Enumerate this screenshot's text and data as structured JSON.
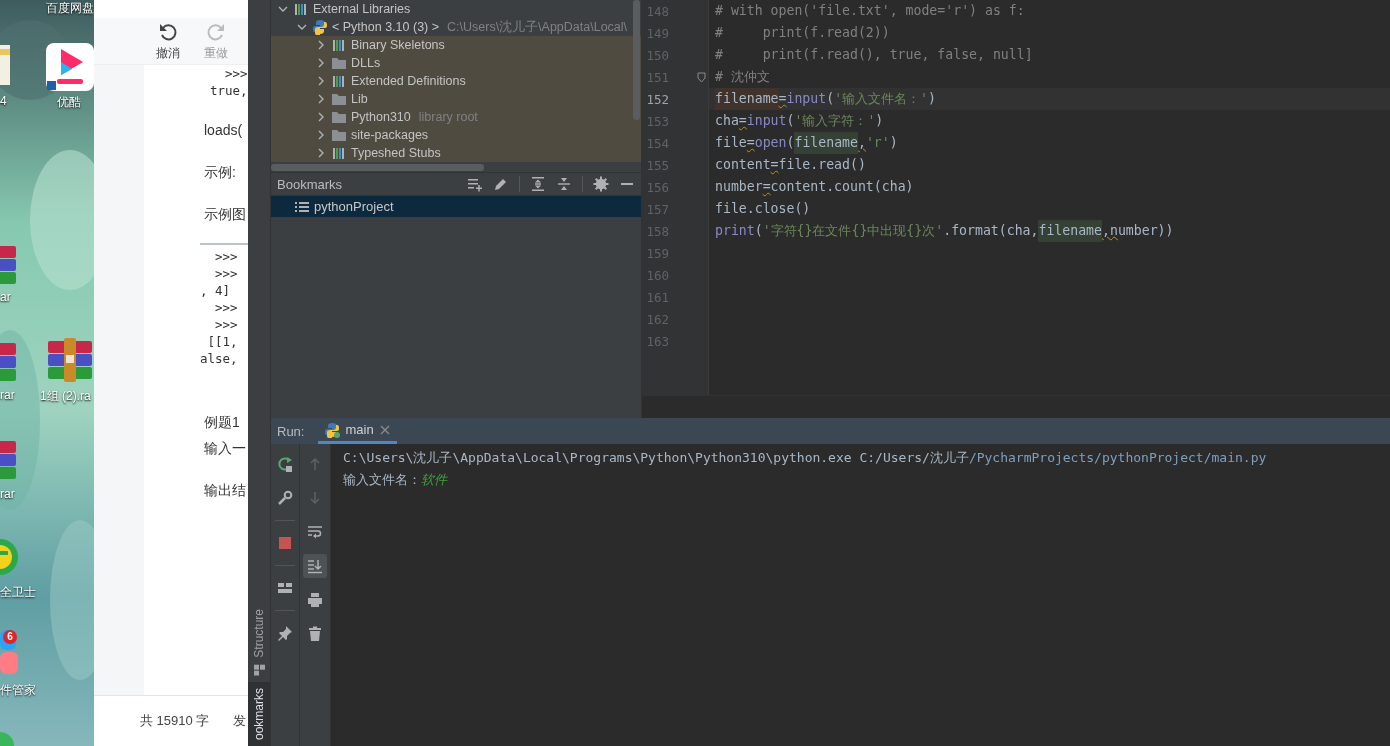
{
  "desktop": {
    "icons": [
      {
        "kind": "cut-label",
        "label": "百度网盘"
      },
      {
        "kind": "file",
        "label": "4"
      },
      {
        "kind": "video-app",
        "label": "优酷"
      },
      {
        "kind": "archive-edge",
        "label": "ar"
      },
      {
        "kind": "archive-edge",
        "label": "rar"
      },
      {
        "kind": "archive",
        "label": "1组 (2).ra"
      },
      {
        "kind": "archive-edge",
        "label": "rar"
      },
      {
        "kind": "security",
        "label": "全卫士"
      },
      {
        "kind": "manager",
        "label": "件管家",
        "badge": "6"
      },
      {
        "kind": "ball"
      }
    ]
  },
  "document_window": {
    "toolbar": [
      {
        "kind": "undo",
        "label": "撤消",
        "disabled": false
      },
      {
        "kind": "redo",
        "label": "重做",
        "disabled": true
      }
    ],
    "blocks": [
      {
        "kind": "code",
        "lines": [
          "  >>>",
          "true,"
        ]
      },
      {
        "kind": "para",
        "text": "loads("
      },
      {
        "kind": "para",
        "text": "示例:"
      },
      {
        "kind": "para",
        "text": "示例图"
      },
      {
        "kind": "code-framed",
        "lines": [
          "  >>>",
          "  >>>",
          ", 4]",
          "  >>>",
          "  >>>",
          " [[1,",
          "alse,"
        ]
      },
      {
        "kind": "para-gap",
        "text": "例题1"
      },
      {
        "kind": "para-tight",
        "text": "输入一"
      },
      {
        "kind": "para",
        "text": "输出结"
      }
    ],
    "footer": [
      "共 15910 字",
      "发"
    ]
  },
  "ide": {
    "side_tabs": [
      {
        "label": "Structure",
        "selected": false
      },
      {
        "label": "ookmarks",
        "selected": true
      }
    ],
    "project_tree": [
      {
        "label": "External Libraries",
        "kind": "library",
        "expanded": true,
        "children": [
          {
            "label": "< Python 3.10 (3) >",
            "hint": "C:\\Users\\沈儿子\\AppData\\Local\\",
            "kind": "python",
            "expanded": true,
            "children": [
              {
                "label": "Binary Skeletons",
                "kind": "library",
                "expanded": false
              },
              {
                "label": "DLLs",
                "kind": "folder",
                "expanded": false
              },
              {
                "label": "Extended Definitions",
                "kind": "library",
                "expanded": false
              },
              {
                "label": "Lib",
                "kind": "folder",
                "expanded": false
              },
              {
                "label": "Python310",
                "hint": "library root",
                "kind": "folder",
                "expanded": false
              },
              {
                "label": "site-packages",
                "kind": "folder",
                "expanded": false
              },
              {
                "label": "Typeshed Stubs",
                "kind": "library",
                "expanded": false
              }
            ]
          }
        ]
      }
    ],
    "bookmarks": {
      "title": "Bookmarks",
      "tools": [
        {
          "kind": "add"
        },
        {
          "kind": "edit"
        },
        {
          "kind": "expand"
        },
        {
          "kind": "collapse"
        },
        {
          "kind": "settings"
        },
        {
          "kind": "hide"
        }
      ],
      "items": [
        {
          "label": "pythonProject",
          "selected": true
        }
      ]
    },
    "editor": {
      "lines": [
        {
          "number": "148",
          "current": false,
          "fold": false,
          "tokens": [
            {
              "kind": "comment",
              "text": "# with open('file.txt', mode='r') as f:"
            }
          ]
        },
        {
          "number": "149",
          "current": false,
          "fold": false,
          "tokens": [
            {
              "kind": "comment",
              "text": "#     print(f.read(2))"
            }
          ]
        },
        {
          "number": "150",
          "current": false,
          "fold": false,
          "tokens": [
            {
              "kind": "comment",
              "text": "#     print(f.read(), true, false, null]"
            }
          ]
        },
        {
          "number": "151",
          "current": false,
          "fold": true,
          "tokens": [
            {
              "kind": "comment",
              "text": "# 沈仲文"
            }
          ]
        },
        {
          "number": "152",
          "current": true,
          "fold": false,
          "tokens": [
            {
              "kind": "var-write",
              "text": "filename"
            },
            {
              "kind": "warn",
              "text": "="
            },
            {
              "kind": "builtin",
              "text": "input"
            },
            {
              "kind": "plain",
              "text": "("
            },
            {
              "kind": "string",
              "text": "'输入文件名：'"
            },
            {
              "kind": "plain",
              "text": ")"
            }
          ]
        },
        {
          "number": "153",
          "current": false,
          "fold": false,
          "tokens": [
            {
              "kind": "plain",
              "text": "cha"
            },
            {
              "kind": "warn",
              "text": "="
            },
            {
              "kind": "builtin",
              "text": "input"
            },
            {
              "kind": "plain",
              "text": "("
            },
            {
              "kind": "string",
              "text": "'输入字符：'"
            },
            {
              "kind": "plain",
              "text": ")"
            }
          ]
        },
        {
          "number": "154",
          "current": false,
          "fold": false,
          "tokens": [
            {
              "kind": "plain",
              "text": "file"
            },
            {
              "kind": "warn",
              "text": "="
            },
            {
              "kind": "builtin",
              "text": "open"
            },
            {
              "kind": "plain",
              "text": "("
            },
            {
              "kind": "var-read",
              "text": "filename"
            },
            {
              "kind": "warn",
              "text": ","
            },
            {
              "kind": "string",
              "text": "'r'"
            },
            {
              "kind": "plain",
              "text": ")"
            }
          ]
        },
        {
          "number": "155",
          "current": false,
          "fold": false,
          "tokens": [
            {
              "kind": "plain",
              "text": "content"
            },
            {
              "kind": "warn",
              "text": "="
            },
            {
              "kind": "plain",
              "text": "file.read()"
            }
          ]
        },
        {
          "number": "156",
          "current": false,
          "fold": false,
          "tokens": [
            {
              "kind": "plain",
              "text": "number"
            },
            {
              "kind": "warn",
              "text": "="
            },
            {
              "kind": "plain",
              "text": "content.count(cha)"
            }
          ]
        },
        {
          "number": "157",
          "current": false,
          "fold": false,
          "tokens": [
            {
              "kind": "plain",
              "text": "file.close()"
            }
          ]
        },
        {
          "number": "158",
          "current": false,
          "fold": false,
          "tokens": [
            {
              "kind": "builtin",
              "text": "print"
            },
            {
              "kind": "plain",
              "text": "("
            },
            {
              "kind": "string",
              "text": "'字符{}在文件{}中出现{}次'"
            },
            {
              "kind": "plain",
              "text": ".format(cha,"
            },
            {
              "kind": "var-read",
              "text": "filename"
            },
            {
              "kind": "lead-warn",
              "text": ",number))"
            }
          ]
        },
        {
          "number": "159",
          "current": false,
          "fold": false
        },
        {
          "number": "160",
          "current": false,
          "fold": false
        },
        {
          "number": "161",
          "current": false,
          "fold": false
        },
        {
          "number": "162",
          "current": false,
          "fold": false
        },
        {
          "number": "163",
          "current": false,
          "fold": false
        }
      ]
    },
    "run": {
      "label": "Run:",
      "tabs": [
        {
          "label": "main",
          "selected": true
        }
      ],
      "tools_left": [
        {
          "kind": "rerun"
        },
        {
          "kind": "wrench"
        },
        {
          "kind": "stop"
        },
        {
          "kind": "layout"
        },
        {
          "kind": "pin"
        }
      ],
      "tools_right": [
        {
          "kind": "up",
          "disabled": true,
          "selected": false
        },
        {
          "kind": "down",
          "disabled": true,
          "selected": false
        },
        {
          "kind": "wrap",
          "disabled": false,
          "selected": false
        },
        {
          "kind": "scroll-end",
          "disabled": false,
          "selected": true
        },
        {
          "kind": "print",
          "disabled": false,
          "selected": false
        },
        {
          "kind": "trash",
          "disabled": false,
          "selected": false
        }
      ],
      "console": [
        {
          "tokens": [
            {
              "kind": "plain",
              "text": "C:\\Users\\沈儿子\\AppData\\Local\\Programs\\Python\\Python310\\python.exe C:/Users/沈儿子"
            },
            {
              "kind": "link",
              "text": "/PycharmProjects/pythonProject/main.py"
            }
          ]
        },
        {
          "tokens": [
            {
              "kind": "plain",
              "text": "输入文件名："
            },
            {
              "kind": "input",
              "text": "软件"
            }
          ]
        }
      ]
    }
  }
}
